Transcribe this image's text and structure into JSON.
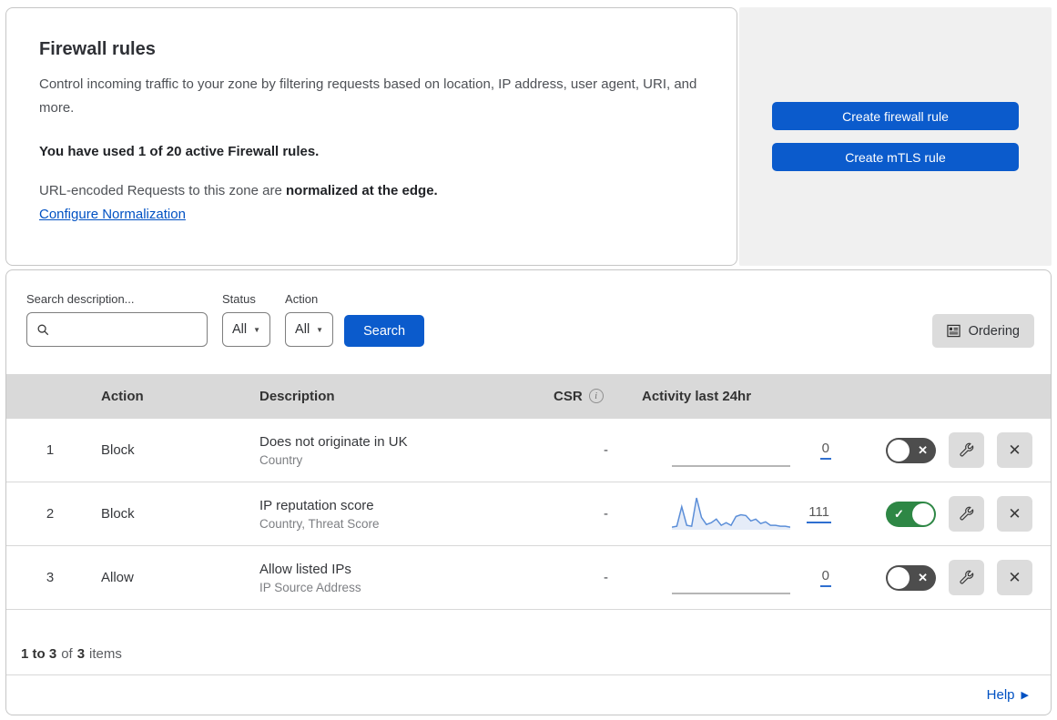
{
  "header": {
    "title": "Firewall rules",
    "description": "Control incoming traffic to your zone by filtering requests based on location, IP address, user agent, URI, and more.",
    "usage": "You have used 1 of 20 active Firewall rules.",
    "normalization_prefix": "URL-encoded Requests to this zone are ",
    "normalization_bold": "normalized at the edge.",
    "normalization_link": "Configure Normalization",
    "buttons": [
      {
        "label": "Create firewall rule"
      },
      {
        "label": "Create mTLS rule"
      }
    ]
  },
  "filters": {
    "search_label": "Search description...",
    "search_value": "",
    "status_label": "Status",
    "status_value": "All",
    "action_label": "Action",
    "action_value": "All",
    "search_button": "Search",
    "ordering_button": "Ordering"
  },
  "table": {
    "headers": {
      "action": "Action",
      "description": "Description",
      "csr": "CSR",
      "activity": "Activity last 24hr"
    },
    "rows": [
      {
        "priority": "1",
        "action": "Block",
        "description": "Does not originate in UK",
        "fields": "Country",
        "csr": "-",
        "activity_count": "0",
        "enabled": false,
        "sparkline": [
          0,
          0
        ]
      },
      {
        "priority": "2",
        "action": "Block",
        "description": "IP reputation score",
        "fields": "Country, Threat Score",
        "csr": "-",
        "activity_count": "111",
        "enabled": true,
        "sparkline": [
          3,
          4,
          26,
          5,
          4,
          36,
          14,
          6,
          8,
          12,
          5,
          8,
          5,
          15,
          17,
          16,
          10,
          12,
          7,
          9,
          5,
          5,
          4,
          4,
          3
        ]
      },
      {
        "priority": "3",
        "action": "Allow",
        "description": "Allow listed IPs",
        "fields": "IP Source Address",
        "csr": "-",
        "activity_count": "0",
        "enabled": false,
        "sparkline": [
          0,
          0
        ]
      }
    ]
  },
  "footer": {
    "range": "1 to 3",
    "of": "of",
    "total": "3",
    "items_label": "items"
  },
  "help": {
    "label": "Help"
  },
  "icons": {
    "check": "✓",
    "cross": "✕",
    "close": "✕",
    "caret": "▼",
    "help_arrow": "▶",
    "info": "i"
  },
  "colors": {
    "primary_blue": "#0b5bcc",
    "link_blue": "#0051c3",
    "toggle_on_green": "#2e8745",
    "toggle_off_gray": "#4d4d4d",
    "header_bar_gray": "#d9d9d9",
    "panel_gray": "#f0f0f0",
    "sparkline_blue": "#5b8ed8",
    "sparkline_flat_gray": "#9e9e9e"
  }
}
